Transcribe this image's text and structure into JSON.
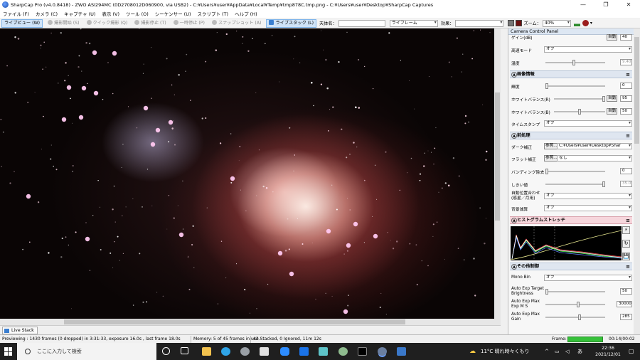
{
  "window": {
    "title": "SharpCap Pro (v4.0.8418) - ZWO ASI294MC (0D2708012D060900, via USB2) - C:¥Users¥user¥AppData¥Local¥Temp¥tmp878C.tmp.png - C:¥Users¥user¥Desktop¥SharpCap Captures",
    "minimize": "—",
    "restore": "❐",
    "close": "✕"
  },
  "menu": [
    "ファイル (F)",
    "カメラ (C)",
    "キャプチャ (U)",
    "表示 (V)",
    "ツール (O)",
    "シーケンサー (U)",
    "スクリプト (T)",
    "ヘルプ (H)"
  ],
  "toolbar": {
    "live_view": "ライブビュー (W)",
    "start_capture": "撮影開始 (S)",
    "quick_capture": "クイック撮影 (Q)",
    "stop_capture": "撮影停止 (T)",
    "pause": "一時停止 (P)",
    "snapshot": "スナップショット (A)",
    "live_stack": "ライブスタック (L)",
    "target_label": "天体名：",
    "target_value": "",
    "frame_select": "ライフレーム",
    "effect_label": "効果：",
    "effect_value": "",
    "zoom_label": "ズーム：",
    "zoom_value": "40%",
    "swatch_color_1": "#777777",
    "swatch_color_2": "#6b1010"
  },
  "panel": {
    "title": "Camera Control Panel",
    "top": {
      "row1_auto": "自動",
      "row1_label": "ゲイン(dB)",
      "row1_value": "40",
      "highspeed_label": "高速モード",
      "highspeed_value": "オフ",
      "temp_label": "温度",
      "temp_value": "9.40"
    },
    "image_section": "画像情報",
    "image": {
      "brightness_label": "輝度",
      "brightness_value": "0",
      "wb_r_label": "ホワイトバランス(R)",
      "wb_r_auto": "自動",
      "wb_r_value": "95",
      "wb_b_label": "ホワイトバランス(B)",
      "wb_b_auto": "自動",
      "wb_b_value": "50",
      "timestamp_label": "タイムスタンプ",
      "timestamp_value": "オフ"
    },
    "pre_section": "前処理",
    "pre": {
      "dark_label": "ダーク補正",
      "dark_browse": "参照...",
      "dark_value": "C:¥Users¥user¥Desktop¥Shar",
      "flat_label": "フラット補正",
      "flat_browse": "参照...",
      "flat_value": "なし",
      "banding_label": "バンディング除去",
      "banding_value": "0",
      "threshold_label": "しきい値",
      "threshold_value": "35.0",
      "autoalign_label_1": "自動位置合わせ",
      "autoalign_label_2": "(惑星／月用)",
      "autoalign_value": "オフ",
      "bgsub_label": "背景減算",
      "bgsub_value": "オフ"
    },
    "histo_section": "ヒストグラムストレッチ",
    "histo_tools": [
      "⚡",
      "↻",
      "💾"
    ],
    "other_section": "その他制御",
    "other": {
      "monobin_label": "Mono Bin",
      "monobin_value": "オフ",
      "aetarget_label_1": "Auto Exp Target",
      "aetarget_label_2": "Brightness",
      "aetarget_value": "50",
      "aemaxexp_label_1": "Auto Exp Max",
      "aemaxexp_label_2": "Exp M S",
      "aemaxexp_value": "30000",
      "aemaxgain_label_1": "Auto Exp Max",
      "aemaxgain_label_2": "Gain",
      "aemaxgain_value": "285"
    }
  },
  "livestack_tab": "Live Stack",
  "status": {
    "preview": "Previewing : 1430 frames (0 dropped) in 3:31:33, exposure 16.0s , last frame 18.0s",
    "memory": "Memory: 5 of 45 frames in use.",
    "stacked": "42 Stacked, 0 Ignored, 11m 12s",
    "frame_label": "Frame:",
    "frame_progress": 1.0,
    "frame_time": "00:14/00:02"
  },
  "taskbar": {
    "search_placeholder": "ここに入力して検索",
    "weather": "11°C  晴れ時々くもり",
    "ime": "あ",
    "time": "22:36",
    "date": "2021/12/01"
  }
}
